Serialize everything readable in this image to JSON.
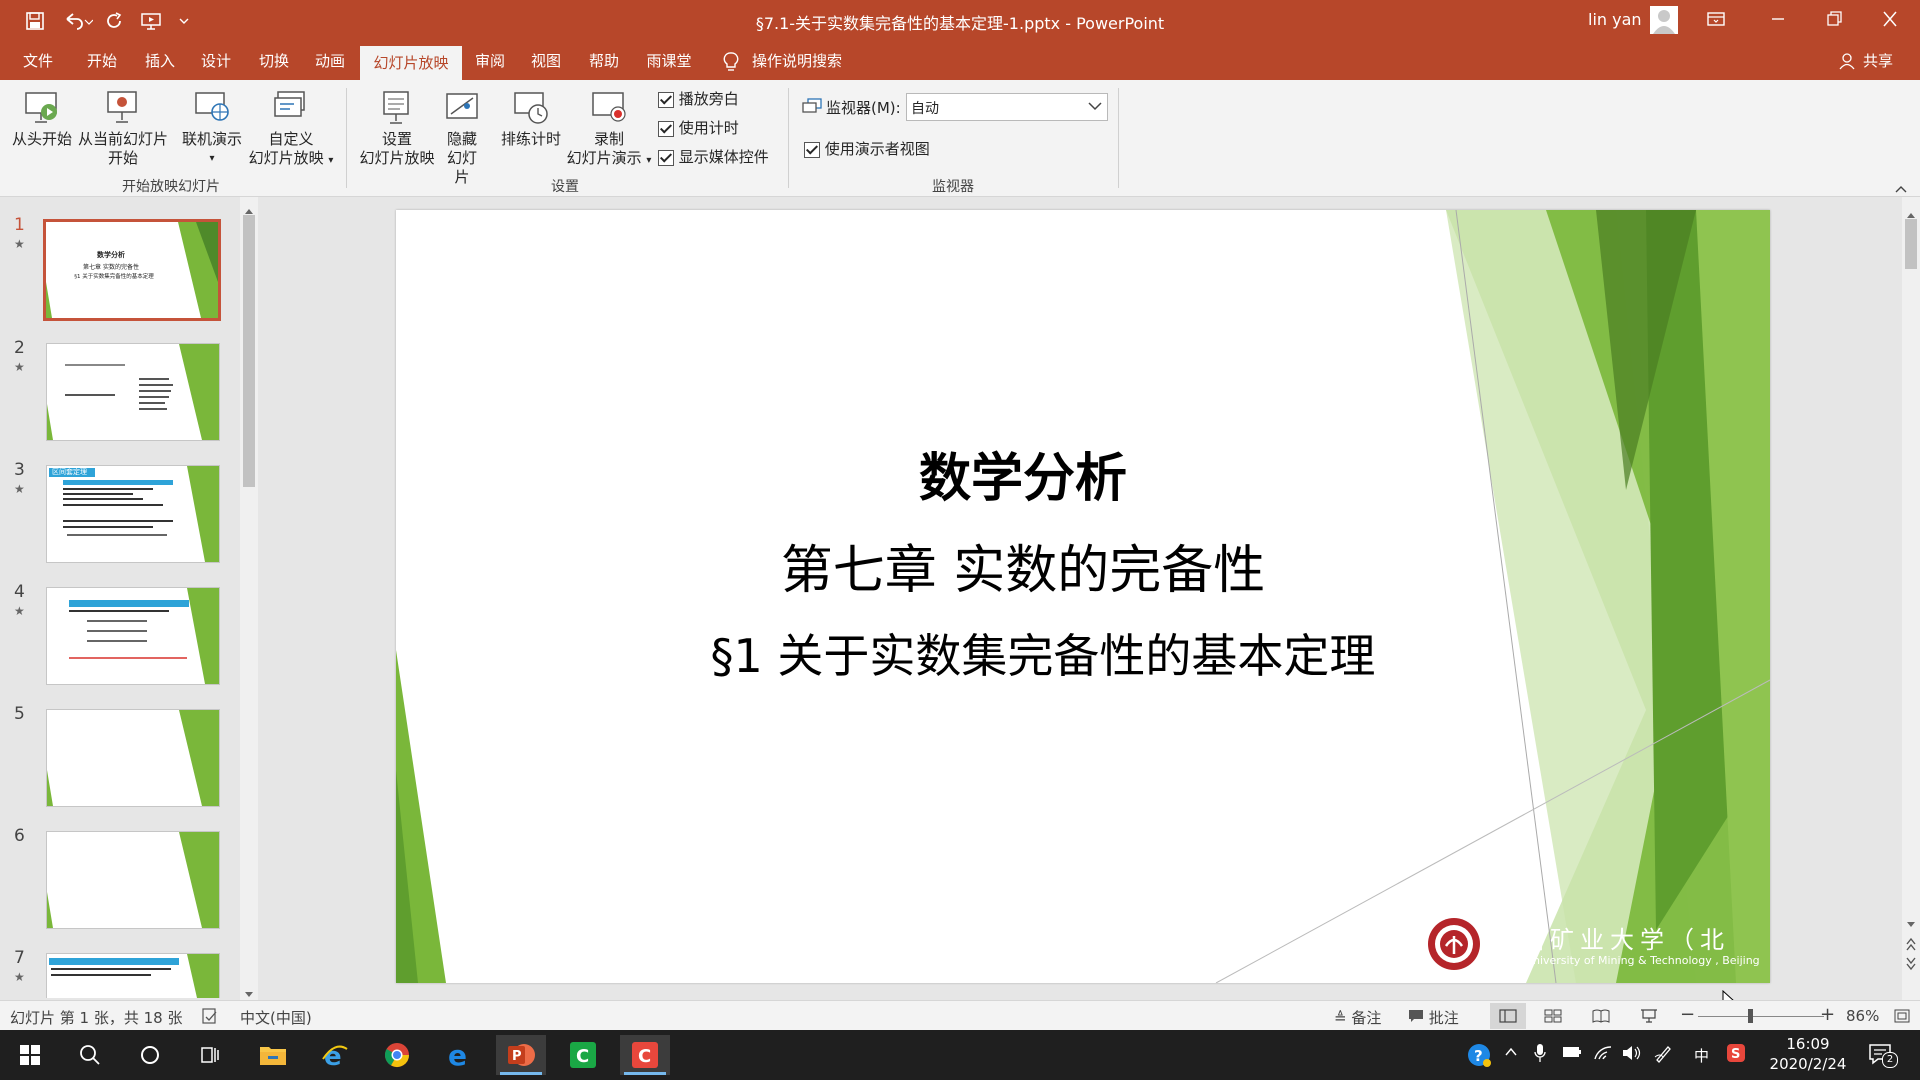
{
  "window": {
    "title": "§7.1-关于实数集完备性的基本定理-1.pptx  -  PowerPoint",
    "user": "lin yan"
  },
  "colors": {
    "accent": "#b7472a",
    "slide_green": "#7ab73a",
    "selection": "#c5533a"
  },
  "qat": {
    "save_icon": "save-icon",
    "undo_icon": "undo-icon",
    "redo_icon": "repeat-icon",
    "present_icon": "present-from-beginning-icon",
    "customize_icon": "customize-qat-icon"
  },
  "tabs": [
    "文件",
    "开始",
    "插入",
    "设计",
    "切换",
    "动画",
    "幻灯片放映",
    "审阅",
    "视图",
    "帮助",
    "雨课堂"
  ],
  "active_tab": "幻灯片放映",
  "tell_me": "操作说明搜索",
  "share": "共享",
  "ribbon": {
    "start_group": {
      "label": "开始放映幻灯片",
      "from_beginning": "从头开始",
      "from_current_1": "从当前幻灯片",
      "from_current_2": "开始",
      "online_present": "联机演示",
      "custom_1": "自定义",
      "custom_2": "幻灯片放映"
    },
    "setup_group": {
      "label": "设置",
      "setup_1": "设置",
      "setup_2": "幻灯片放映",
      "hide_1": "隐藏",
      "hide_2": "幻灯片",
      "rehearse": "排练计时",
      "record_1": "录制",
      "record_2": "幻灯片演示",
      "play_narrations": "播放旁白",
      "use_timings": "使用计时",
      "show_media_controls": "显示媒体控件"
    },
    "monitors_group": {
      "label": "监视器",
      "monitor_label": "监视器(M):",
      "monitor_value": "自动",
      "presenter_view": "使用演示者视图"
    }
  },
  "thumbnails": [
    {
      "num": "1",
      "title": "数学分析",
      "line2": "第七章  实数的完备性",
      "line3": "§1 关于实数集完备性的基本定理",
      "selected": true
    },
    {
      "num": "2",
      "title": "",
      "line2": "",
      "line3": "",
      "selected": false
    },
    {
      "num": "3",
      "title": "区间套定理",
      "line2": "",
      "line3": "",
      "selected": false
    },
    {
      "num": "4",
      "title": "",
      "line2": "",
      "line3": "",
      "selected": false
    },
    {
      "num": "5",
      "title": "",
      "line2": "",
      "line3": "",
      "selected": false
    },
    {
      "num": "6",
      "title": "",
      "line2": "",
      "line3": "",
      "selected": false
    },
    {
      "num": "7",
      "title": "",
      "line2": "",
      "line3": "",
      "selected": false
    }
  ],
  "slide": {
    "title": "数学分析",
    "subtitle": "第七章  实数的完备性",
    "section": "§1 关于实数集完备性的基本定理",
    "logo_cn": "中国矿业大学（北京）",
    "logo_en": "China University of Mining & Technology , Beijing"
  },
  "status": {
    "slide_info": "幻灯片 第 1 张，共 18 张",
    "language": "中文(中国)",
    "notes": "备注",
    "comments": "批注",
    "zoom": "86%"
  },
  "taskbar": {
    "time": "16:09",
    "date": "2020/2/24",
    "ime": "中",
    "notification_count": "2"
  }
}
